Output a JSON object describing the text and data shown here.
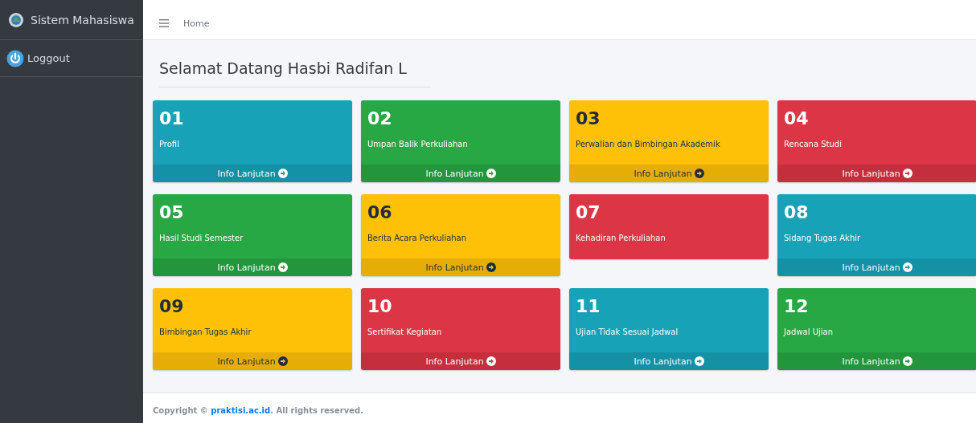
{
  "sidebar": {
    "brand": "Sistem Mahasiswa",
    "items": [
      {
        "label": "Loggout"
      }
    ]
  },
  "topbar": {
    "breadcrumb": "Home"
  },
  "page_title": "Selamat Datang Hasbi Radifan L",
  "cards": [
    {
      "number": "01",
      "label": "Profil",
      "color": "#17a2b8",
      "link": "Info Lanjutan"
    },
    {
      "number": "02",
      "label": "Umpan Balik Perkuliahan",
      "color": "#28a745",
      "link": "Info Lanjutan"
    },
    {
      "number": "03",
      "label": "Perwalian dan Bimbingan Akademik",
      "color": "#ffc107",
      "link": "Info Lanjutan"
    },
    {
      "number": "04",
      "label": "Rencana Studi",
      "color": "#dc3545",
      "link": "Info Lanjutan"
    },
    {
      "number": "05",
      "label": "Hasil Studi Semester",
      "color": "#28a745",
      "link": "Info Lanjutan"
    },
    {
      "number": "06",
      "label": "Berita Acara Perkuliahan",
      "color": "#ffc107",
      "link": "Info Lanjutan"
    },
    {
      "number": "07",
      "label": "Kehadiran Perkuliahan",
      "color": "#dc3545"
    },
    {
      "number": "08",
      "label": "Sidang Tugas Akhir",
      "color": "#17a2b8",
      "link": "Info Lanjutan"
    },
    {
      "number": "09",
      "label": "Bimbingan Tugas Akhir",
      "color": "#ffc107",
      "link": "Info Lanjutan"
    },
    {
      "number": "10",
      "label": "Sertifikat Kegiatan",
      "color": "#dc3545",
      "link": "Info Lanjutan"
    },
    {
      "number": "11",
      "label": "Ujian Tidak Sesuai Jadwal",
      "color": "#17a2b8",
      "link": "Info Lanjutan"
    },
    {
      "number": "12",
      "label": "Jadwal Ujian",
      "color": "#28a745",
      "link": "Info Lanjutan"
    }
  ],
  "footer": {
    "prefix": "Copyright ©",
    "link": "praktisi.ac.id",
    "suffix": ". All rights reserved."
  }
}
